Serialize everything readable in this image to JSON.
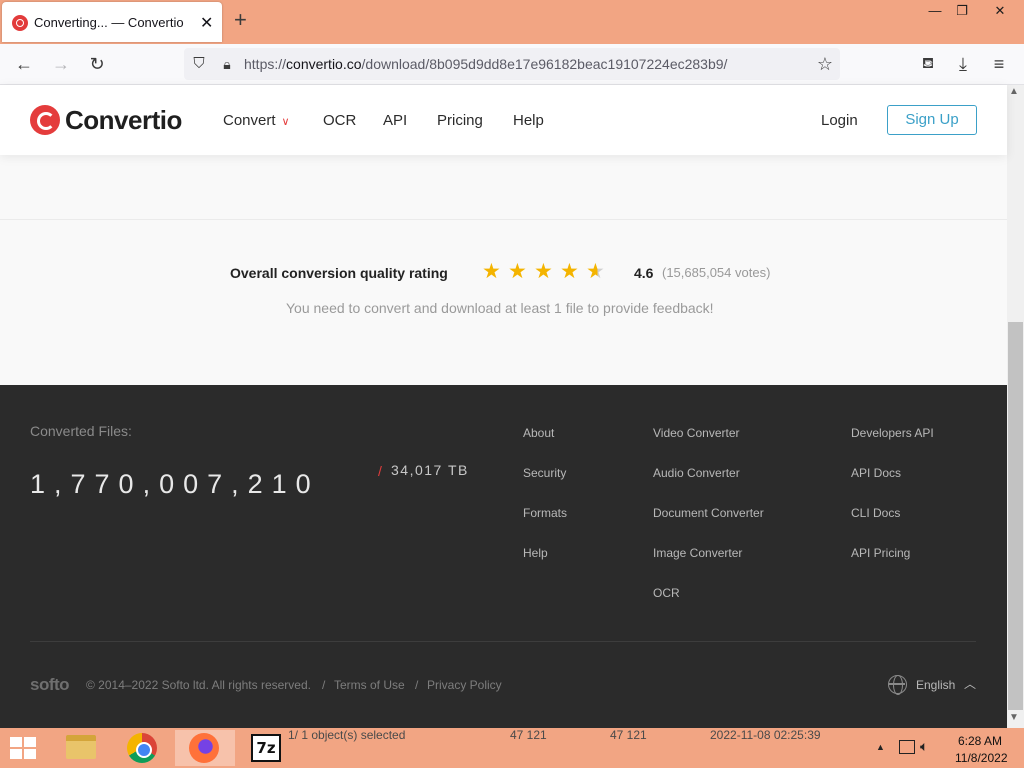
{
  "browser": {
    "tab_title": "Converting... — Convertio",
    "tab_close": "✕",
    "new_tab": "+",
    "window_controls": {
      "minimize": "—",
      "restore": "❐",
      "close": "✕"
    },
    "url_prefix": "https://",
    "url_host": "convertio.co",
    "url_path": "/download/8b095d9dd8e17e96182beac19107224ec283b9/",
    "icons": [
      "back-icon",
      "forward-icon",
      "reload-icon",
      "shield-icon",
      "lock-icon",
      "bookmark-star-icon",
      "pocket-icon",
      "download-icon",
      "menu-icon"
    ]
  },
  "site": {
    "logo": "Convertio",
    "nav": {
      "convert": "Convert",
      "ocr": "OCR",
      "api": "API",
      "pricing": "Pricing",
      "help": "Help"
    },
    "login": "Login",
    "signup": "Sign Up",
    "accent_color": "#e43c3c",
    "signup_color": "#3ba0c8"
  },
  "rating": {
    "label": "Overall conversion quality rating",
    "score": "4.6",
    "stars": 4.6,
    "votes": "(15,685,054 votes)",
    "feedback": "You need to convert and download at least 1 file to provide feedback!",
    "star_color": "#f4b400"
  },
  "footer": {
    "converted_label": "Converted Files:",
    "count": "1,770,007,210",
    "slash": "/",
    "size": "34,017 TB",
    "col1": [
      "About",
      "Security",
      "Formats",
      "Help"
    ],
    "col2": [
      "Video Converter",
      "Audio Converter",
      "Document Converter",
      "Image Converter",
      "OCR"
    ],
    "col3": [
      "Developers API",
      "API Docs",
      "CLI Docs",
      "API Pricing"
    ],
    "brand": "softo",
    "copyright": "© 2014–2022 Softo ltd. All rights reserved.",
    "sep": "/",
    "terms": "Terms of Use",
    "privacy": "Privacy Policy",
    "language": "English"
  },
  "taskbar": {
    "status_selected": "1/ 1 object(s) selected",
    "status_size1": "47 121",
    "status_size2": "47 121",
    "status_date": "2022-11-08 02:25:39",
    "sevenzip_label": "7z",
    "time": "6:28 AM",
    "date": "11/8/2022"
  }
}
